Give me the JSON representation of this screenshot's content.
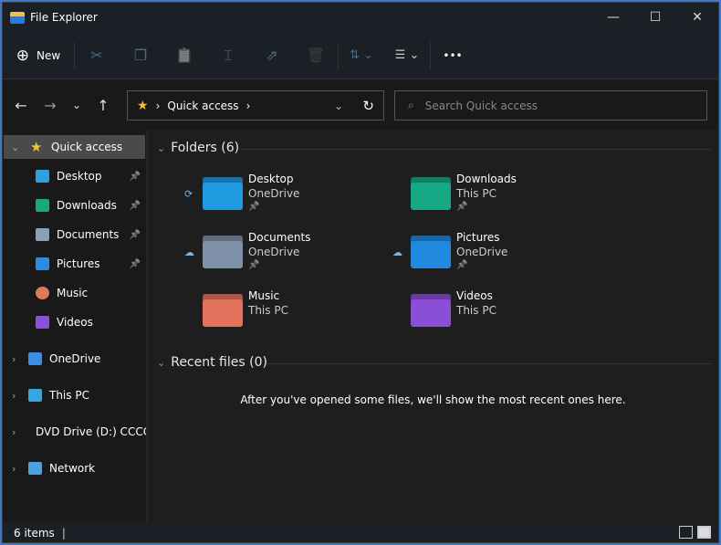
{
  "window": {
    "title": "File Explorer",
    "minimize": "—",
    "maximize": "☐",
    "close": "✕"
  },
  "toolbar": {
    "new_label": "New",
    "new_icon": "⊕",
    "cut": "✂",
    "copy": "❐",
    "paste": "📋",
    "rename": "⌶",
    "share": "⇗",
    "delete": "🗑",
    "sort": "⇅ ⌄",
    "view": "☰ ⌄",
    "more": "•••"
  },
  "nav": {
    "back": "←",
    "forward": "→",
    "recent": "⌄",
    "up": "↑"
  },
  "address": {
    "icon": "★",
    "sep": "›",
    "location": "Quick access",
    "sep2": "›",
    "dropdown": "⌄",
    "refresh": "↻"
  },
  "search": {
    "icon": "⌕",
    "placeholder": "Search Quick access"
  },
  "sidebar": {
    "items": [
      {
        "label": "Quick access",
        "chevron": "⌄",
        "icon": "star-icon",
        "color": "#f4c430"
      },
      {
        "label": "Desktop",
        "pinned": true,
        "icon": "desktop-icon",
        "color": "#2ea0dc"
      },
      {
        "label": "Downloads",
        "pinned": true,
        "icon": "download-icon",
        "color": "#1aa77a"
      },
      {
        "label": "Documents",
        "pinned": true,
        "icon": "document-icon",
        "color": "#8aa0b8"
      },
      {
        "label": "Pictures",
        "pinned": true,
        "icon": "pictures-icon",
        "color": "#2b8de0"
      },
      {
        "label": "Music",
        "icon": "music-icon",
        "color": "#e0785a"
      },
      {
        "label": "Videos",
        "icon": "videos-icon",
        "color": "#8b4fd8"
      },
      {
        "label": "OneDrive",
        "chevron": "›",
        "icon": "cloud-icon",
        "color": "#3a8ee6"
      },
      {
        "label": "This PC",
        "chevron": "›",
        "icon": "monitor-icon",
        "color": "#35a7e0"
      },
      {
        "label": "DVD Drive (D:) CCCC",
        "chevron": "›",
        "icon": "dvd-icon",
        "color": "#4caf50"
      },
      {
        "label": "Network",
        "chevron": "›",
        "icon": "network-icon",
        "color": "#4aa3df"
      }
    ],
    "pin": "📌"
  },
  "main": {
    "folders_header": "Folders (6)",
    "folders": [
      {
        "name": "Desktop",
        "location": "OneDrive",
        "pinned": true,
        "status": "⟳",
        "color": "#1e9be0"
      },
      {
        "name": "Downloads",
        "location": "This PC",
        "pinned": true,
        "color": "#17a886"
      },
      {
        "name": "Documents",
        "location": "OneDrive",
        "pinned": true,
        "status": "☁",
        "color": "#7f92aa"
      },
      {
        "name": "Pictures",
        "location": "OneDrive",
        "pinned": true,
        "status": "☁",
        "color": "#2088de"
      },
      {
        "name": "Music",
        "location": "This PC",
        "color": "#e3725c"
      },
      {
        "name": "Videos",
        "location": "This PC",
        "color": "#8a4fd6"
      }
    ],
    "recent_header": "Recent files (0)",
    "recent_message": "After you've opened some files, we'll show the most recent ones here."
  },
  "status": {
    "items": "6 items"
  }
}
